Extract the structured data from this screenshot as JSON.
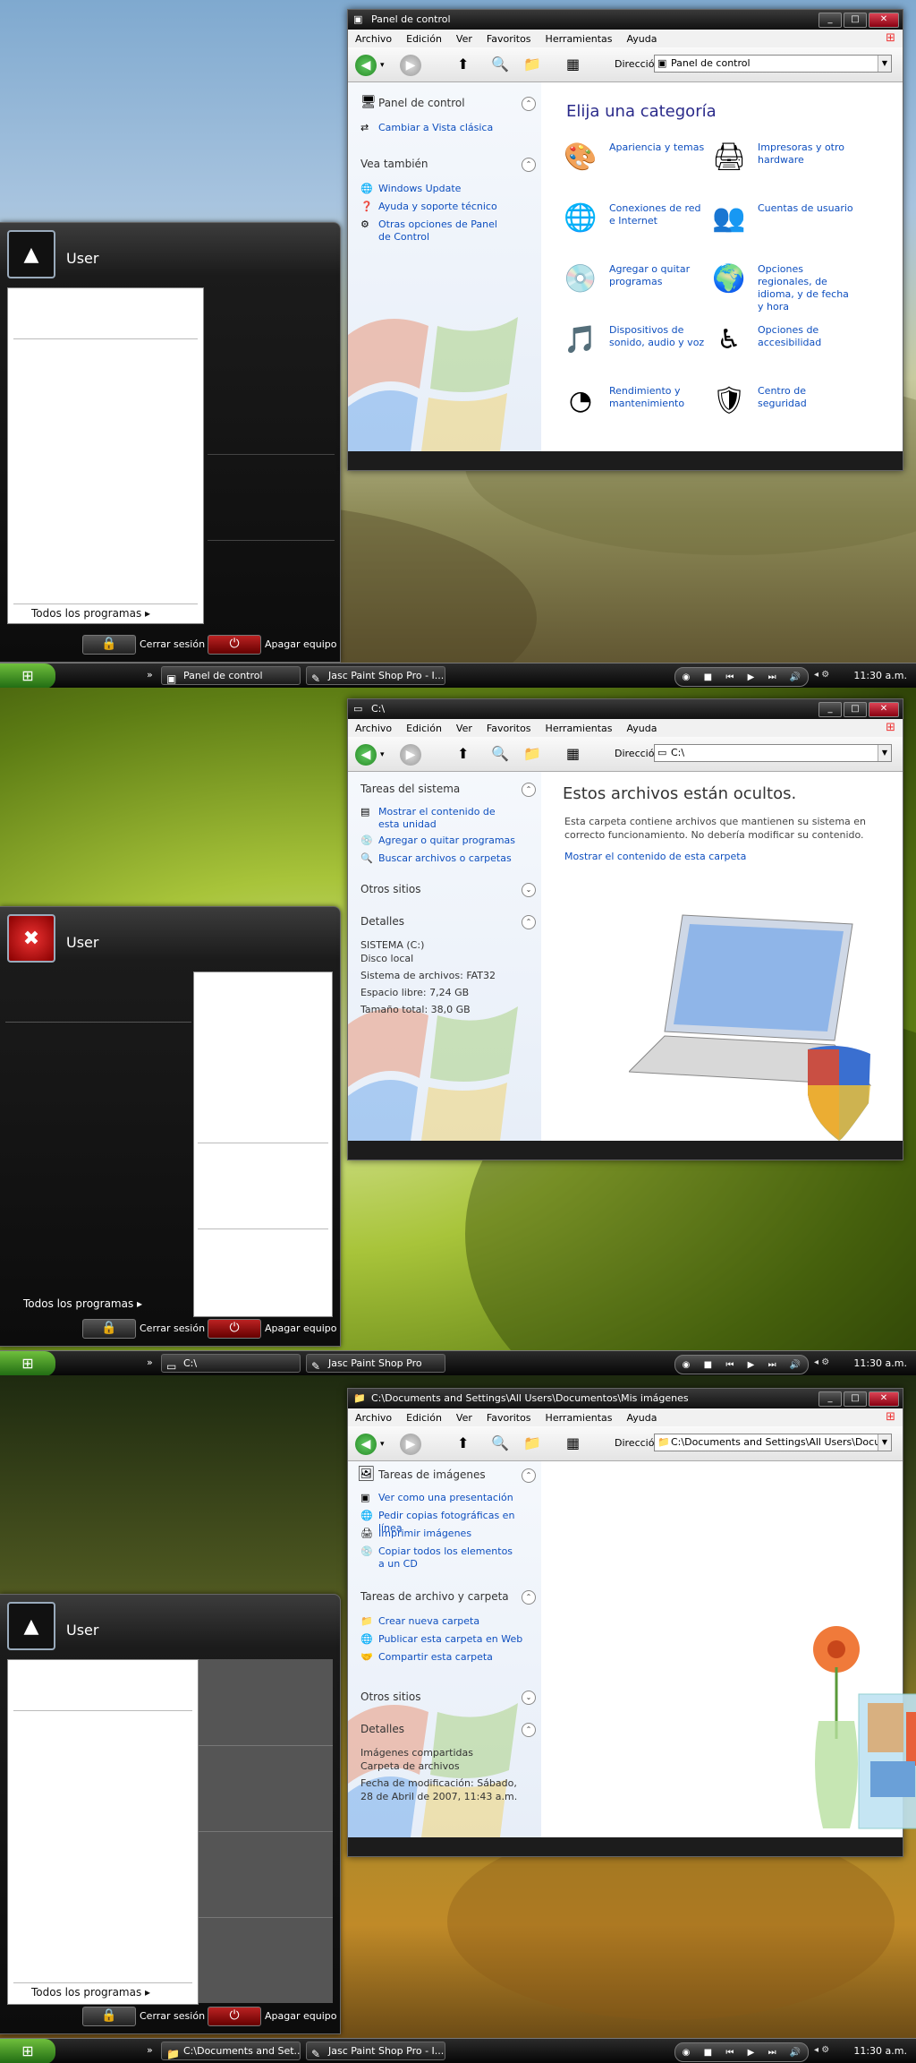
{
  "screens": [
    {
      "start_menu": {
        "user": "User",
        "all_programs": "Todos los programas",
        "logoff": "Cerrar sesión",
        "shutdown": "Apagar equipo"
      },
      "taskbar": {
        "items": [
          "Panel de control",
          "Jasc Paint Shop Pro - I..."
        ],
        "time": "11:30 a.m."
      },
      "window": {
        "title": "Panel de control",
        "menu": [
          "Archivo",
          "Edición",
          "Ver",
          "Favoritos",
          "Herramientas",
          "Ayuda"
        ],
        "address_label": "Dirección",
        "address": "Panel de control",
        "taskpane": {
          "header": "Panel de control",
          "link1": "Cambiar a Vista clásica",
          "see_also": "Vea también",
          "links": [
            "Windows Update",
            "Ayuda y soporte técnico",
            "Otras opciones de Panel de Control"
          ]
        },
        "main": {
          "title": "Elija una categoría",
          "categories": [
            "Apariencia y temas",
            "Impresoras y otro hardware",
            "Conexiones de red e Internet",
            "Cuentas de usuario",
            "Agregar o quitar programas",
            "Opciones regionales, de idioma, y de fecha y hora",
            "Dispositivos de sonido, audio y voz",
            "Opciones de accesibilidad",
            "Rendimiento y mantenimiento",
            "Centro de seguridad"
          ]
        }
      }
    },
    {
      "start_menu": {
        "user": "User",
        "all_programs": "Todos los programas",
        "logoff": "Cerrar sesión",
        "shutdown": "Apagar equipo"
      },
      "taskbar": {
        "items": [
          "C:\\",
          "Jasc Paint Shop Pro"
        ],
        "time": "11:30 a.m."
      },
      "window": {
        "title": "C:\\",
        "menu": [
          "Archivo",
          "Edición",
          "Ver",
          "Favoritos",
          "Herramientas",
          "Ayuda"
        ],
        "address_label": "Dirección",
        "address": "C:\\",
        "taskpane": {
          "header1": "Tareas del sistema",
          "links": [
            "Mostrar el contenido de esta unidad",
            "Agregar o quitar programas",
            "Buscar archivos o carpetas"
          ],
          "header2": "Otros sitios",
          "header3": "Detalles",
          "details": [
            "SISTEMA (C:)",
            "Disco local",
            "Sistema de archivos: FAT32",
            "Espacio libre: 7,24 GB",
            "Tamaño total: 38,0 GB"
          ]
        },
        "main": {
          "title": "Estos archivos están ocultos.",
          "desc": "Esta carpeta contiene archivos que mantienen su sistema en correcto funcionamiento. No debería modificar su contenido.",
          "link": "Mostrar el contenido de esta carpeta"
        }
      }
    },
    {
      "start_menu": {
        "user": "User",
        "all_programs": "Todos los programas",
        "logoff": "Cerrar sesión",
        "shutdown": "Apagar equipo"
      },
      "taskbar": {
        "items": [
          "C:\\Documents and Set...",
          "Jasc Paint Shop Pro - I..."
        ],
        "time": "11:30 a.m."
      },
      "window": {
        "title": "C:\\Documents and Settings\\All Users\\Documentos\\Mis imágenes",
        "menu": [
          "Archivo",
          "Edición",
          "Ver",
          "Favoritos",
          "Herramientas",
          "Ayuda"
        ],
        "address_label": "Dirección",
        "address": "C:\\Documents and Settings\\All Users\\Documer",
        "taskpane": {
          "header1": "Tareas de imágenes",
          "links1": [
            "Ver como una presentación",
            "Pedir copias fotográficas en línea",
            "Imprimir imágenes",
            "Copiar todos los elementos a un CD"
          ],
          "header2": "Tareas de archivo y carpeta",
          "links2": [
            "Crear nueva carpeta",
            "Publicar esta carpeta en Web",
            "Compartir esta carpeta"
          ],
          "header3": "Otros sitios",
          "header4": "Detalles",
          "details": [
            "Imágenes compartidas",
            "Carpeta de archivos",
            "Fecha de modificación: Sábado, 28 de Abril de 2007, 11:43 a.m."
          ]
        }
      }
    }
  ],
  "icons": {
    "start": "windows-logo",
    "user_avatar_1": "prism-icon",
    "user_avatar_2": "crossed-hammers-icon",
    "user_avatar_3": "prism-icon"
  }
}
